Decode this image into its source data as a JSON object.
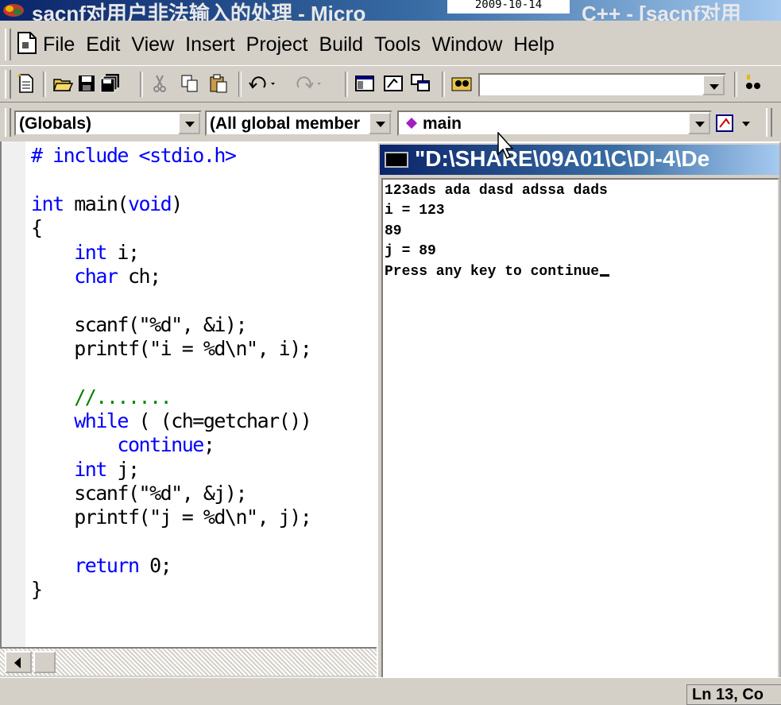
{
  "window": {
    "title_left": "sacnf对用户非法输入的处理 - Micro",
    "date_overlay": "2009-10-14",
    "title_right": "C++ - [sacnf对用"
  },
  "menu": {
    "items": [
      "File",
      "Edit",
      "View",
      "Insert",
      "Project",
      "Build",
      "Tools",
      "Window",
      "Help"
    ]
  },
  "toolbar": {
    "find_value": ""
  },
  "wizardbar": {
    "class_combo": "(Globals)",
    "filter_combo": "(All global member",
    "function_combo": "main"
  },
  "editor": {
    "lines": [
      "# include <stdio.h>",
      "",
      "int main(void)",
      "{",
      "    int i;",
      "    char ch;",
      "",
      "    scanf(\"%d\", &i);",
      "    printf(\"i = %d\\n\", i);",
      "",
      "    //.......",
      "    while ( (ch=getchar())",
      "        continue;",
      "    int j;",
      "    scanf(\"%d\", &j);",
      "    printf(\"j = %d\\n\", j);",
      "",
      "    return 0;",
      "}"
    ]
  },
  "console": {
    "title": "\"D:\\SHARE\\09A01\\C\\DI-4\\De",
    "output": [
      "123ads ada dasd adssa dads",
      "i = 123",
      "89",
      "j = 89",
      "Press any key to continue"
    ]
  },
  "statusbar": {
    "position": "Ln 13, Co"
  },
  "colors": {
    "keyword": "#0000ff",
    "comment": "#008000",
    "titlebar_start": "#0a246a",
    "titlebar_end": "#a6caf0",
    "chrome": "#d4d0c8"
  },
  "icons": [
    "app-icon",
    "new-document-icon",
    "open-folder-icon",
    "save-icon",
    "save-all-icon",
    "cut-icon",
    "copy-icon",
    "paste-icon",
    "undo-icon",
    "redo-icon",
    "workspace-icon",
    "output-icon",
    "window-list-icon",
    "find-in-files-icon",
    "find-icon",
    "wizard-action-icon",
    "console-icon",
    "mouse-pointer-icon"
  ]
}
